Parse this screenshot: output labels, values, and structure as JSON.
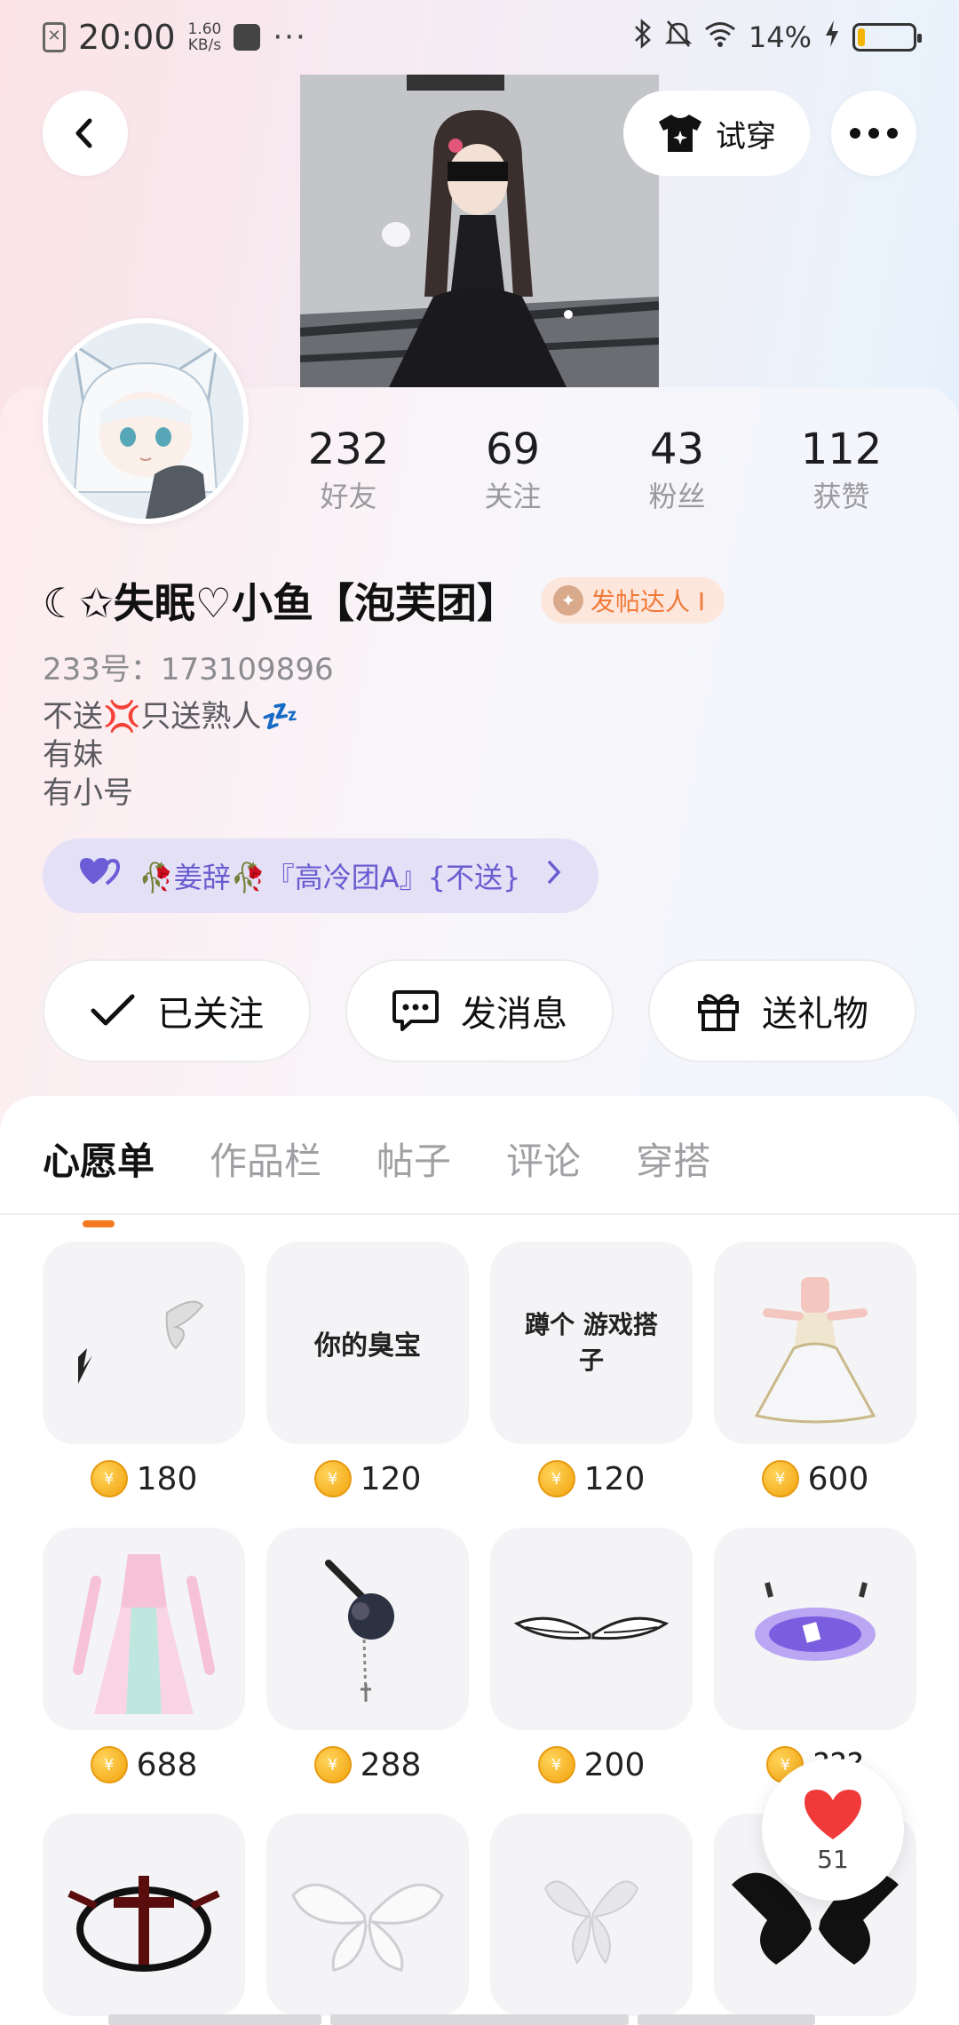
{
  "status_bar": {
    "time": "20:00",
    "speed_value": "1.60",
    "speed_unit": "KB/s",
    "dots": "···",
    "battery": "14%",
    "battery_level": 0.14
  },
  "header": {
    "tryon_label": "试穿"
  },
  "stats": [
    {
      "num": "232",
      "label": "好友"
    },
    {
      "num": "69",
      "label": "关注"
    },
    {
      "num": "43",
      "label": "粉丝"
    },
    {
      "num": "112",
      "label": "获赞"
    }
  ],
  "profile": {
    "name": "☾✩失眠♡小鱼【泡芙团】",
    "badge": "发帖达人 I",
    "uid": "233号：173109896",
    "bio": [
      "不送💢只送熟人💤",
      "有妹",
      "有小号"
    ],
    "group": "🥀姜辞🥀『高冷团A』{不送}"
  },
  "actions": {
    "followed": "已关注",
    "message": "发消息",
    "gift": "送礼物"
  },
  "tabs": [
    "心愿单",
    "作品栏",
    "帖子",
    "评论",
    "穿搭"
  ],
  "items": [
    {
      "price": "180",
      "art": "butterfly-small",
      "text": ""
    },
    {
      "price": "120",
      "art": "text",
      "text": "你的臭宝"
    },
    {
      "price": "120",
      "art": "text2",
      "text": "蹲个 游戏搭子"
    },
    {
      "price": "600",
      "art": "dress-white",
      "text": ""
    },
    {
      "price": "688",
      "art": "dress-pink",
      "text": ""
    },
    {
      "price": "288",
      "art": "chain",
      "text": ""
    },
    {
      "price": "200",
      "art": "wings-small",
      "text": ""
    },
    {
      "price": "???",
      "art": "platform",
      "text": ""
    },
    {
      "price": "",
      "art": "sigil",
      "text": ""
    },
    {
      "price": "",
      "art": "wings-white",
      "text": ""
    },
    {
      "price": "",
      "art": "fairy-wings",
      "text": ""
    },
    {
      "price": "",
      "art": "wings-dark",
      "text": ""
    }
  ],
  "like": {
    "count": "51"
  }
}
